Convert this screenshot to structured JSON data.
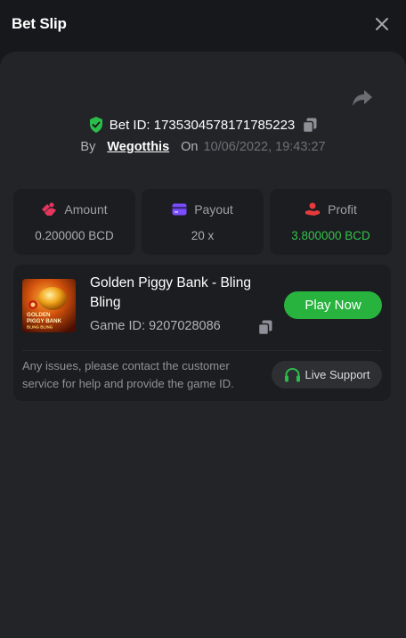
{
  "header": {
    "title": "Bet Slip"
  },
  "bet": {
    "id_label": "Bet ID: 1735304578171785223",
    "by_label": "By",
    "username": "Wegotthis",
    "on_label": "On",
    "datetime": "10/06/2022, 19:43:27"
  },
  "stats": [
    {
      "label": "Amount",
      "value": "0.200000 BCD",
      "icon": "coins-icon",
      "color": "#e2365d"
    },
    {
      "label": "Payout",
      "value": "20 x",
      "icon": "card-icon",
      "color": "#7c4dff"
    },
    {
      "label": "Profit",
      "value": "3.800000 BCD",
      "icon": "profit-icon",
      "color": "#e53b3b"
    }
  ],
  "game": {
    "name": "Golden Piggy Bank - Bling Bling",
    "id_label": "Game ID: 9207028086",
    "play_label": "Play Now",
    "thumb_line1": "GOLDEN",
    "thumb_line2": "PIGGY BANK",
    "thumb_line3": "BLING BLING"
  },
  "support": {
    "notice": "Any issues, please contact the customer service for help and provide the game ID.",
    "button_label": "Live Support"
  },
  "colors": {
    "accent_green": "#27b33e",
    "profit_green": "#33c24d",
    "shield_green": "#2bbd4a"
  }
}
